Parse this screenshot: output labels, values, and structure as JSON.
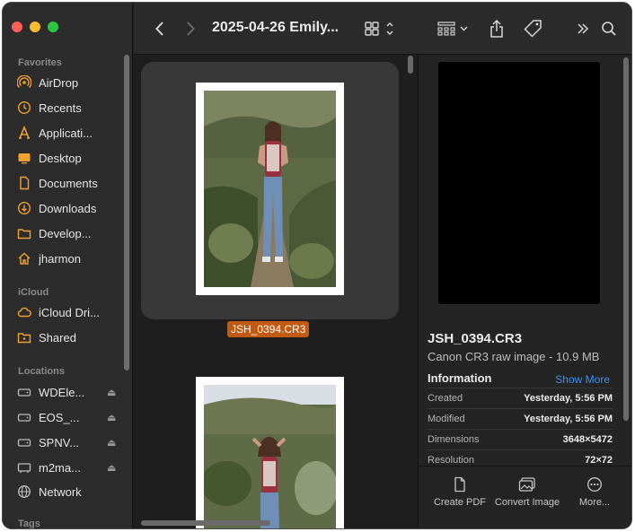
{
  "window": {
    "title": "2025-04-26 Emily..."
  },
  "sidebar": {
    "sections": {
      "favorites": "Favorites",
      "icloud": "iCloud",
      "locations": "Locations",
      "tags": "Tags"
    },
    "favorites": [
      {
        "label": "AirDrop",
        "icon": "airdrop-icon"
      },
      {
        "label": "Recents",
        "icon": "clock-icon"
      },
      {
        "label": "Applicati...",
        "icon": "applications-icon"
      },
      {
        "label": "Desktop",
        "icon": "desktop-icon"
      },
      {
        "label": "Documents",
        "icon": "document-icon"
      },
      {
        "label": "Downloads",
        "icon": "download-icon"
      },
      {
        "label": "Develop...",
        "icon": "folder-icon"
      },
      {
        "label": "jharmon",
        "icon": "home-icon"
      }
    ],
    "icloud": [
      {
        "label": "iCloud Dri...",
        "icon": "cloud-icon"
      },
      {
        "label": "Shared",
        "icon": "shared-folder-icon"
      }
    ],
    "locations": [
      {
        "label": "WDEle...",
        "icon": "drive-icon"
      },
      {
        "label": "EOS_...",
        "icon": "drive-icon"
      },
      {
        "label": "SPNV...",
        "icon": "drive-icon"
      },
      {
        "label": "m2ma...",
        "icon": "drive-icon"
      },
      {
        "label": "Network",
        "icon": "globe-icon"
      }
    ]
  },
  "content": {
    "selected_file": "JSH_0394.CR3"
  },
  "preview": {
    "filename": "JSH_0394.CR3",
    "subtitle": "Canon CR3 raw image - 10.9 MB",
    "info_heading": "Information",
    "show_more": "Show More",
    "info": [
      {
        "key": "Created",
        "value": "Yesterday, 5:56 PM"
      },
      {
        "key": "Modified",
        "value": "Yesterday, 5:56 PM"
      },
      {
        "key": "Dimensions",
        "value": "3648×5472"
      },
      {
        "key": "Resolution",
        "value": "72×72"
      }
    ],
    "actions": [
      {
        "label": "Create PDF",
        "icon": "pdf-icon"
      },
      {
        "label": "Convert Image",
        "icon": "convert-image-icon"
      },
      {
        "label": "More...",
        "icon": "more-icon"
      }
    ]
  },
  "colors": {
    "accent": "#3d8ff6",
    "selection_label": "#c35a12",
    "folder_icon": "#f0a030"
  }
}
